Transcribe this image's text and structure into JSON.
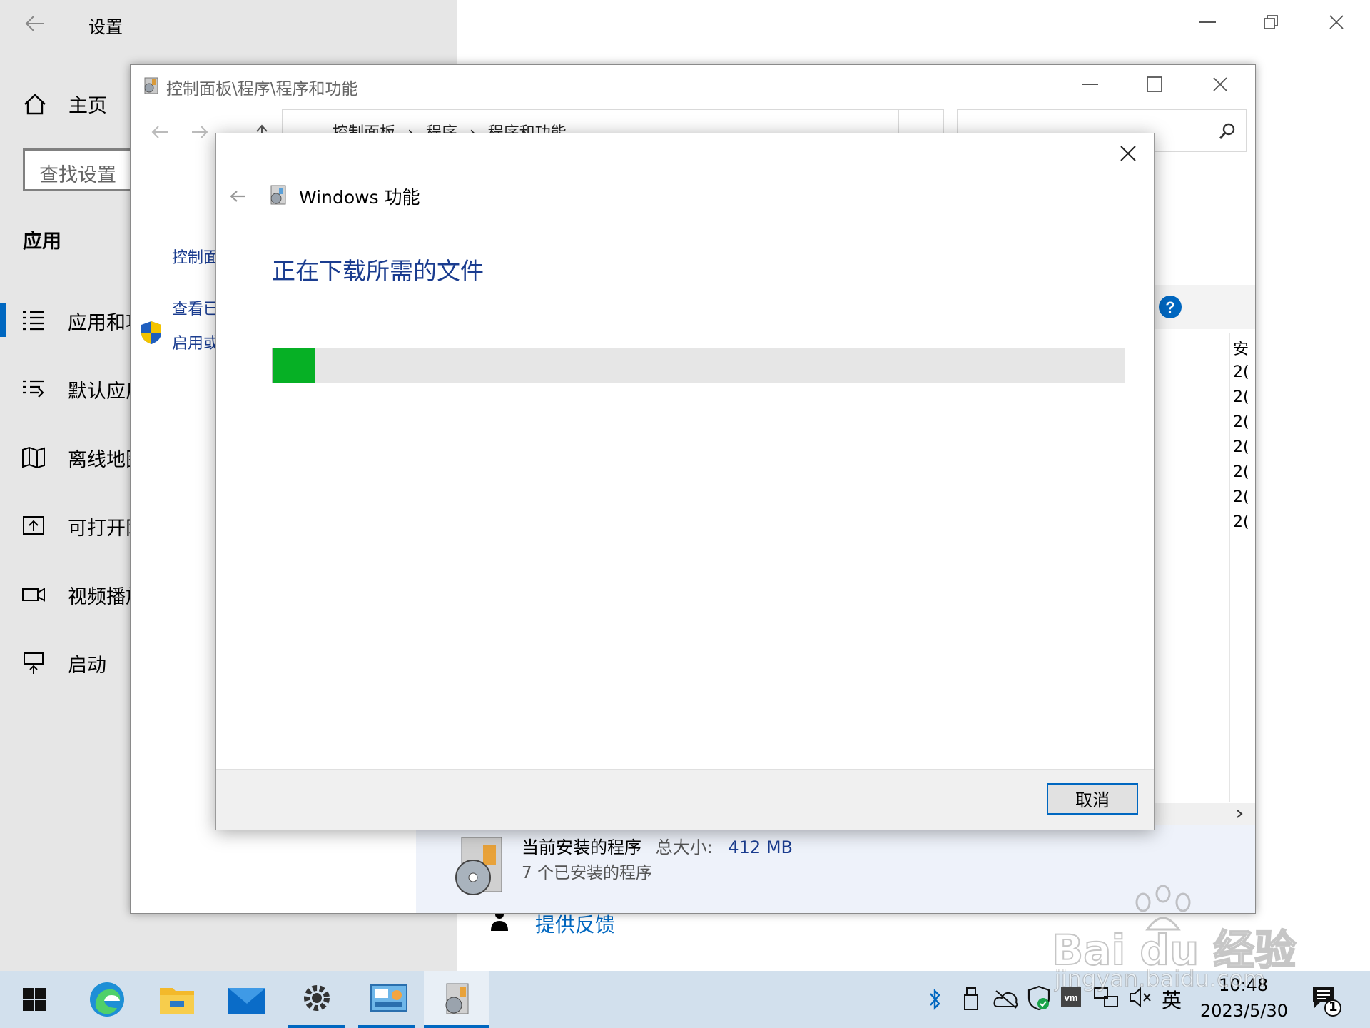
{
  "settings": {
    "title": "设置",
    "home_label": "主页",
    "search_placeholder": "查找设置",
    "section": "应用",
    "nav": [
      "应用和功能",
      "默认应用",
      "离线地图",
      "可打开网站的应用",
      "视频播放",
      "启动"
    ]
  },
  "control_panel": {
    "title": "控制面板\\程序\\程序和功能",
    "breadcrumb": [
      "控制面板",
      "程序",
      "程序和功能"
    ],
    "left_links": [
      "控制面板主页",
      "查看已安装的更新",
      "启用或关闭 Windows 功能"
    ],
    "list_column_fragment": "安",
    "list_date_fragments": [
      "2(",
      "2(",
      "2(",
      "2(",
      "2(",
      "2(",
      "2("
    ],
    "status": {
      "label": "当前安装的程序",
      "size_label": "总大小:",
      "size_value": "412 MB",
      "count_text": "7 个已安装的程序"
    }
  },
  "dialog": {
    "title": "Windows 功能",
    "heading": "正在下载所需的文件",
    "progress": 0.05,
    "cancel_label": "取消"
  },
  "feedback_label": "提供反馈",
  "taskbar": {
    "time": "10:48",
    "date": "2023/5/30",
    "ime": "英",
    "notification_count": "1"
  },
  "watermark": {
    "brand": "Bai du 经验",
    "url": "jingyan.baidu.com"
  },
  "colors": {
    "accent": "#0067c0",
    "progress_green": "#06b025",
    "heading_blue": "#1a3c8f"
  }
}
